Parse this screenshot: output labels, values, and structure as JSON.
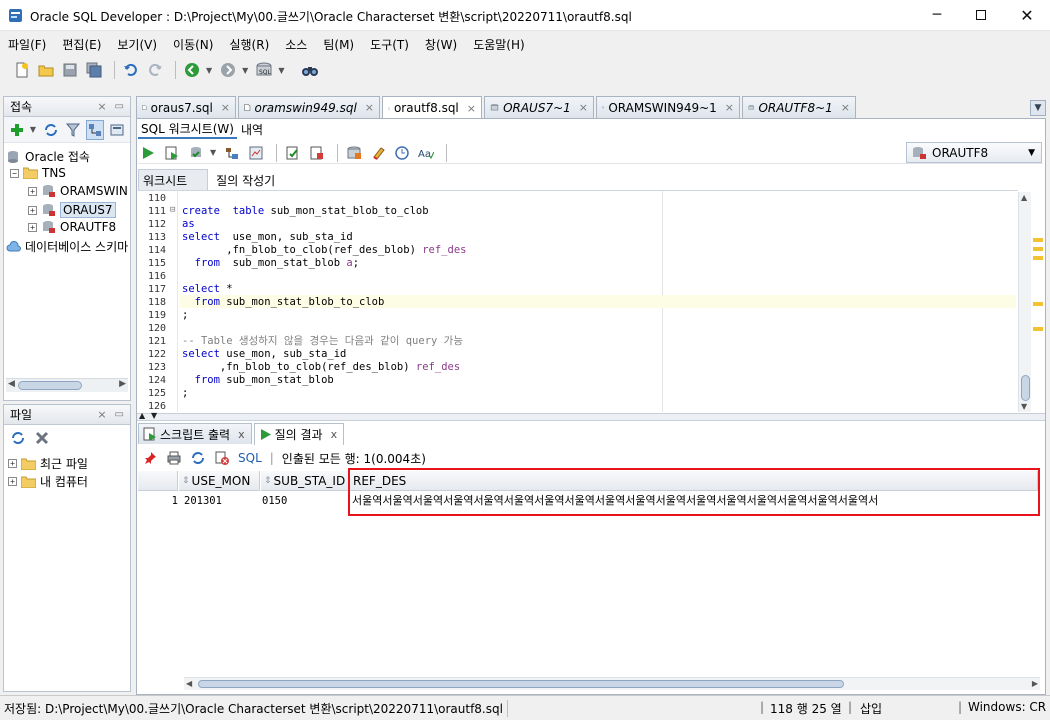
{
  "window": {
    "title": "Oracle SQL Developer : D:\\Project\\My\\00.글쓰기\\Oracle Characterset 변환\\script\\20220711\\orautf8.sql"
  },
  "menu": [
    "파일(F)",
    "편집(E)",
    "보기(V)",
    "이동(N)",
    "실행(R)",
    "소스",
    "팀(M)",
    "도구(T)",
    "창(W)",
    "도움말(H)"
  ],
  "connections_panel": {
    "title": "접속",
    "root": "Oracle 접속",
    "tns": "TNS",
    "items": [
      "ORAMSWIN",
      "ORAUS7",
      "ORAUTF8"
    ],
    "db_schema": "데이터베이스 스키마"
  },
  "files_panel": {
    "title": "파일",
    "items": [
      "최근 파일",
      "내 컴퓨터"
    ]
  },
  "editor_tabs": [
    {
      "label": "oraus7.sql"
    },
    {
      "label": "oramswin949.sql"
    },
    {
      "label": "orautf8.sql"
    },
    {
      "label": "ORAUS7~1"
    },
    {
      "label": "ORAMSWIN949~1"
    },
    {
      "label": "ORAUTF8~1"
    }
  ],
  "worksheet": {
    "subtabs": [
      "SQL 워크시트(W)",
      "내역"
    ],
    "connection": "ORAUTF8",
    "inner_tabs": [
      "워크시트",
      "질의 작성기"
    ]
  },
  "code": [
    {
      "n": "110",
      "t": ""
    },
    {
      "n": "111",
      "t": "create  table sub_mon_stat_blob_to_clob"
    },
    {
      "n": "112",
      "t": "as"
    },
    {
      "n": "113",
      "t": "select  use_mon, sub_sta_id"
    },
    {
      "n": "114",
      "t": "       ,fn_blob_to_clob(ref_des_blob) ref_des"
    },
    {
      "n": "115",
      "t": "  from  sub_mon_stat_blob a;"
    },
    {
      "n": "116",
      "t": ""
    },
    {
      "n": "117",
      "t": "select *"
    },
    {
      "n": "118",
      "t": "  from sub_mon_stat_blob_to_clob"
    },
    {
      "n": "119",
      "t": ";"
    },
    {
      "n": "120",
      "t": ""
    },
    {
      "n": "121",
      "t": "-- Table 생성하지 않을 경우는 다음과 같이 query 가능"
    },
    {
      "n": "122",
      "t": "select use_mon, sub_sta_id"
    },
    {
      "n": "123",
      "t": "      ,fn_blob_to_clob(ref_des_blob) ref_des"
    },
    {
      "n": "124",
      "t": "  from sub_mon_stat_blob"
    },
    {
      "n": "125",
      "t": ";"
    },
    {
      "n": "126",
      "t": ""
    }
  ],
  "results": {
    "tabs": [
      "스크립트 출력",
      "질의 결과"
    ],
    "sql_label": "SQL",
    "status": "인출된 모든 행: 1(0.004초)",
    "columns": [
      "USE_MON",
      "SUB_STA_ID",
      "REF_DES"
    ],
    "rows": [
      {
        "num": "1",
        "use_mon": "201301",
        "sub_sta_id": "0150",
        "ref_des": "서울역서울역서울역서울역서울역서울역서울역서울역서울역서울역서울역서울역서울역서울역서울역서울역서울역서"
      }
    ]
  },
  "statusbar": {
    "path": "저장됨: D:\\Project\\My\\00.글쓰기\\Oracle Characterset 변환\\script\\20220711\\orautf8.sql",
    "position": "118 행 25 열",
    "mode": "삽입",
    "encoding": "Windows: CR"
  },
  "colors": {
    "highlight_box": "#e8131b",
    "keyword": "#0000cc",
    "comment": "#808080",
    "current_line": "#fdfde6"
  }
}
